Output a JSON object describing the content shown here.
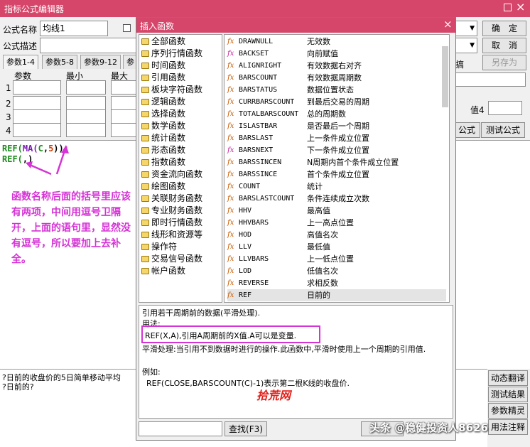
{
  "editor": {
    "title": "指标公式编辑器",
    "name_label": "公式名称",
    "name_value": "均线1",
    "desc_label": "公式描述",
    "confirm_btn": "确　定",
    "cancel_btn": "取　消",
    "saveas_btn": "另存为",
    "tabs": [
      "参数1-4",
      "参数5-8",
      "参数9-12",
      "参"
    ],
    "param_headers": [
      "参数",
      "最小",
      "最大"
    ],
    "param_rows": [
      "1",
      "2",
      "3",
      "4"
    ],
    "side_label_ge": "搞",
    "side_label_val4": "值4",
    "formula_btn_partial": "公式",
    "test_formula_btn": "测试公式",
    "code_lines": [
      {
        "a": "REF(",
        "b": "MA(",
        "c": "C",
        "d": ",",
        "e": "5",
        "f": "));"
      },
      {
        "a": "REF(",
        "b": ",)",
        "c": "",
        "d": "",
        "e": "",
        "f": ""
      }
    ],
    "annotation": "函数名称后面的括号里应该有两项，中间用逗号卫隔开，上面的语句里，显然没有逗号，所以要加上去补全。",
    "status_lines": [
      "?日前的收盘价的5日简单移动平均",
      "?日前的?"
    ],
    "right_buttons": [
      "动态翻译",
      "测试结果",
      "参数精灵",
      "用法注释"
    ]
  },
  "dialog": {
    "title": "插入函数",
    "close": "×",
    "categories": [
      "全部函数",
      "序列行情函数",
      "时间函数",
      "引用函数",
      "板块字符函数",
      "逻辑函数",
      "选择函数",
      "数学函数",
      "统计函数",
      "形态函数",
      "指数函数",
      "资金流向函数",
      "绘图函数",
      "关联财务函数",
      "专业财务函数",
      "即时行情函数",
      "线形和资源等",
      "操作符",
      "交易信号函数",
      "帐户函数"
    ],
    "functions": [
      {
        "name": "DRAWNULL",
        "desc": "无效数",
        "pink": false
      },
      {
        "name": "BACKSET",
        "desc": "向前赋值",
        "pink": true
      },
      {
        "name": "ALIGNRIGHT",
        "desc": "有效数据右对齐",
        "pink": false
      },
      {
        "name": "BARSCOUNT",
        "desc": "有效数据周期数",
        "pink": false
      },
      {
        "name": "BARSTATUS",
        "desc": "数据位置状态",
        "pink": false
      },
      {
        "name": "CURRBARSCOUNT",
        "desc": "到最后交易的周期",
        "pink": false
      },
      {
        "name": "TOTALBARSCOUNT",
        "desc": "总的周期数",
        "pink": false
      },
      {
        "name": "ISLASTBAR",
        "desc": "是否最后一个周期",
        "pink": false
      },
      {
        "name": "BARSLAST",
        "desc": "上一条件成立位置",
        "pink": false
      },
      {
        "name": "BARSNEXT",
        "desc": "下一条件成立位置",
        "pink": true
      },
      {
        "name": "BARSSINCEN",
        "desc": "N周期内首个条件成立位置",
        "pink": false
      },
      {
        "name": "BARSSINCE",
        "desc": "首个条件成立位置",
        "pink": false
      },
      {
        "name": "COUNT",
        "desc": "统计",
        "pink": false
      },
      {
        "name": "BARSLASTCOUNT",
        "desc": "条件连续成立次数",
        "pink": false
      },
      {
        "name": "HHV",
        "desc": "最高值",
        "pink": false
      },
      {
        "name": "HHVBARS",
        "desc": "上一高点位置",
        "pink": false
      },
      {
        "name": "HOD",
        "desc": "高值名次",
        "pink": false
      },
      {
        "name": "LLV",
        "desc": "最低值",
        "pink": false
      },
      {
        "name": "LLVBARS",
        "desc": "上一低点位置",
        "pink": false
      },
      {
        "name": "LOD",
        "desc": "低值名次",
        "pink": false
      },
      {
        "name": "REVERSE",
        "desc": "求相反数",
        "pink": false
      },
      {
        "name": "REF",
        "desc": "日前的",
        "pink": false
      }
    ],
    "help": {
      "line1": "引用若干周期前的数据(平滑处理).",
      "usage_label": "用法:",
      "usage": "REF(X,A),引用A周期前的X值.A可以是变量.",
      "smooth": "平滑处理:当引用不到数据时进行的操作.此函数中,平滑时使用上一个周期的引用值.",
      "example_label": "例如:",
      "example": "REF(CLOSE,BARSCOUNT(C)-1)表示第二根K线的收盘价."
    },
    "watermark": "拾荒网",
    "search_btn": "查找(F3)"
  },
  "toutiao": "头条 @稳健投资人8626",
  "colors": {
    "titlebar": "#d5466a",
    "annotation": "#d633d6",
    "highlight": "#d633d6"
  }
}
